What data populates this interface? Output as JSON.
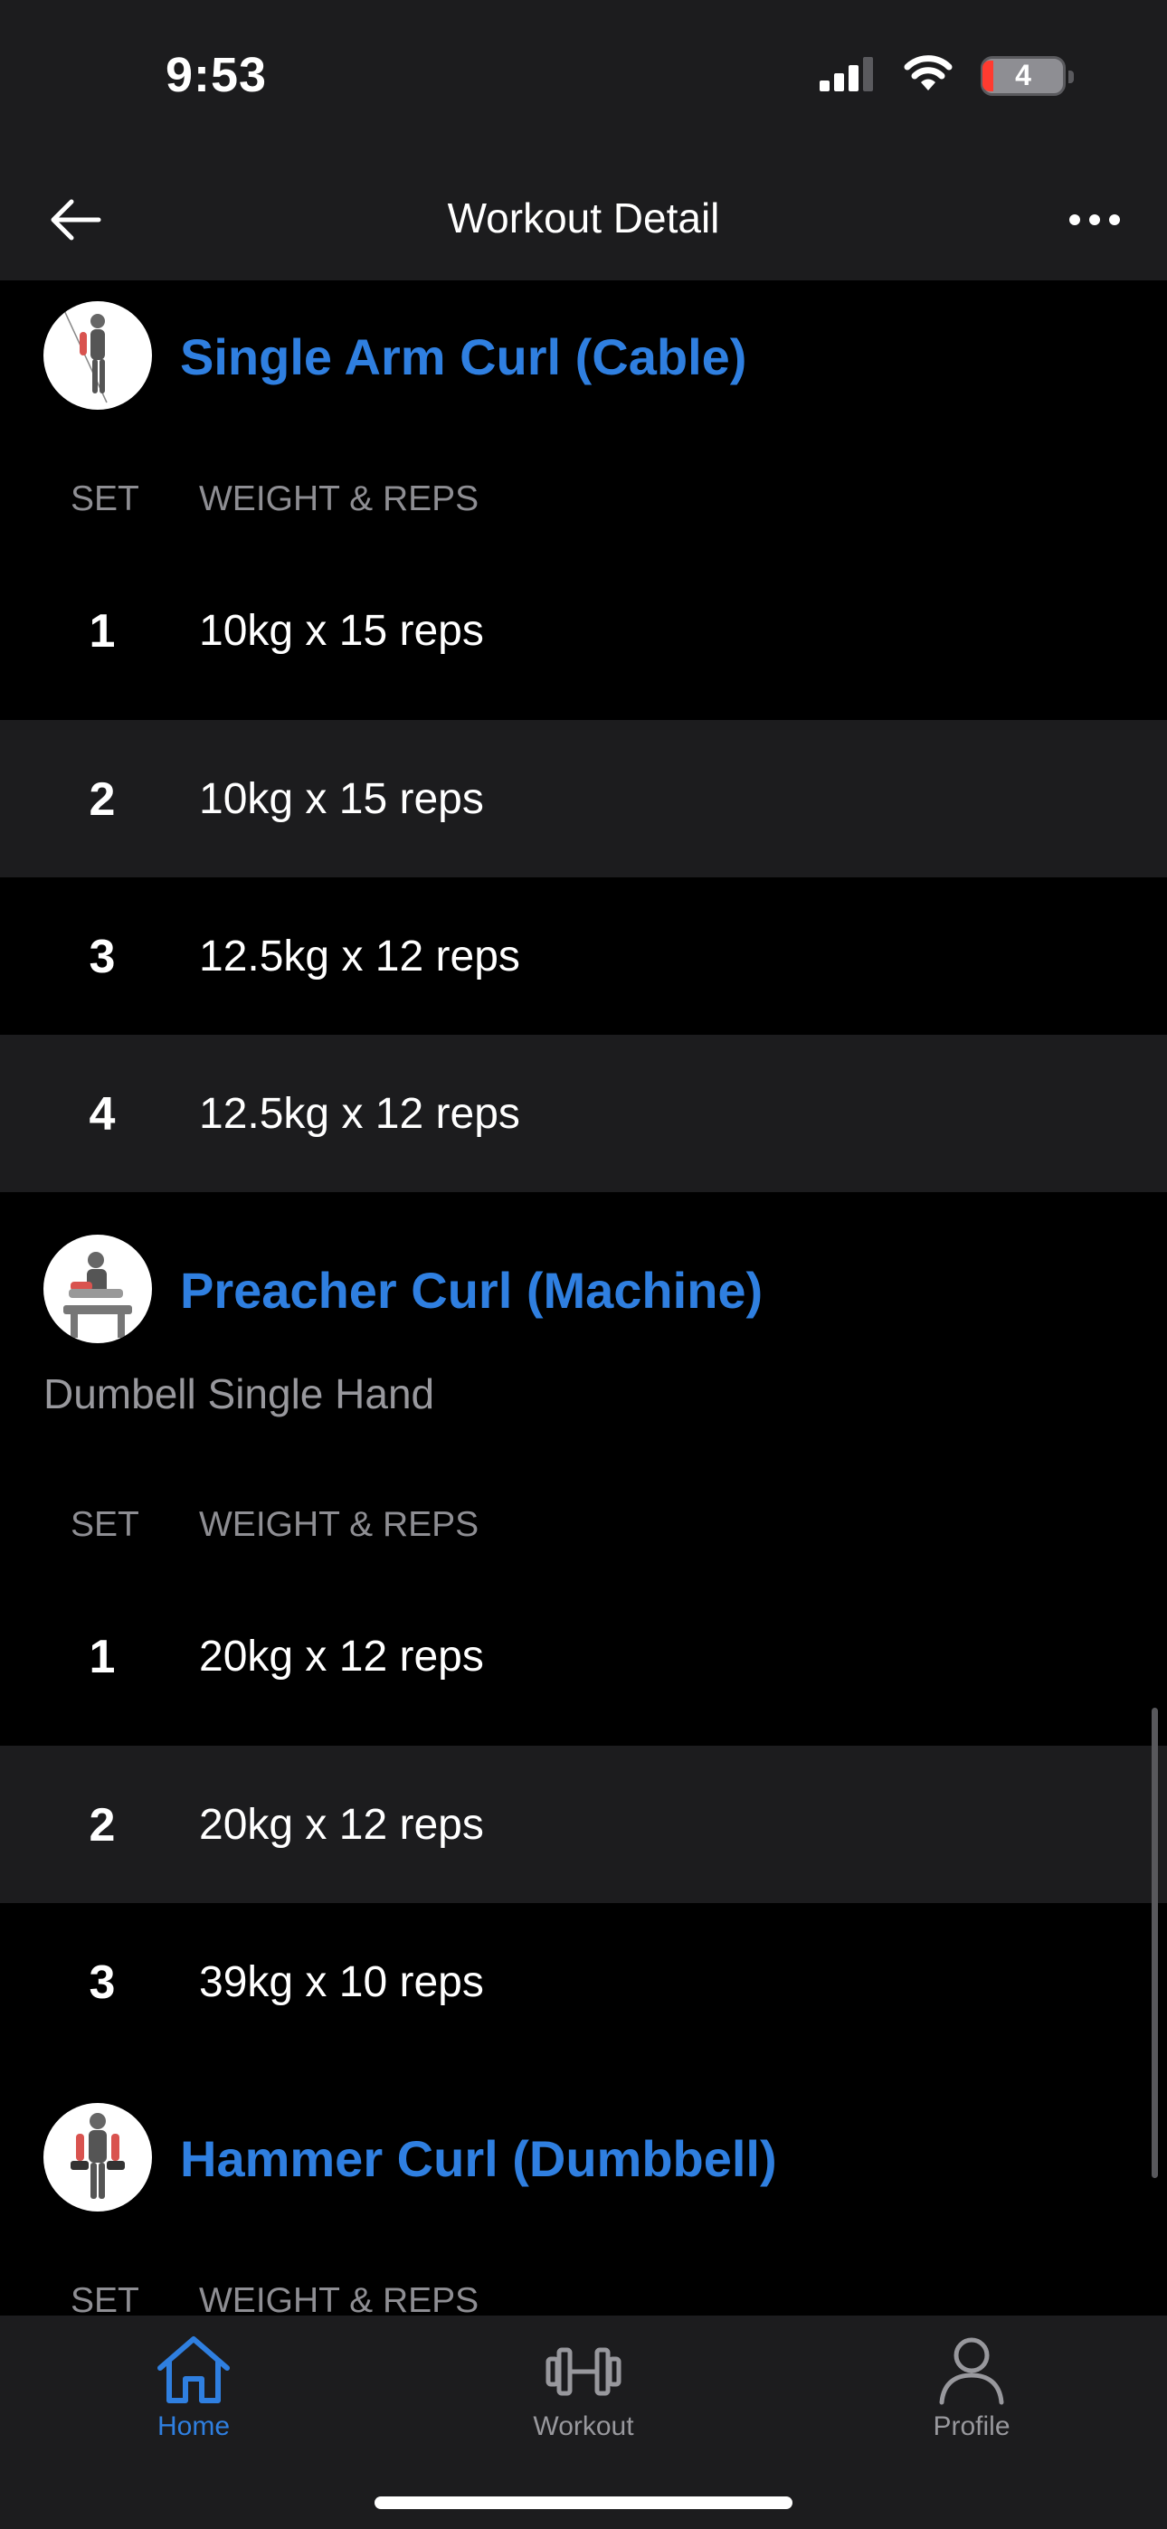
{
  "status_bar": {
    "time": "9:53",
    "battery": "4"
  },
  "nav": {
    "title": "Workout Detail"
  },
  "columns": {
    "set": "SET",
    "weight_reps": "WEIGHT & REPS"
  },
  "exercises": [
    {
      "name": "Single Arm Curl (Cable)",
      "sets": [
        {
          "num": "1",
          "value": "10kg x 15 reps"
        },
        {
          "num": "2",
          "value": "10kg x 15 reps"
        },
        {
          "num": "3",
          "value": "12.5kg x 12 reps"
        },
        {
          "num": "4",
          "value": "12.5kg x 12 reps"
        }
      ]
    },
    {
      "name": "Preacher Curl (Machine)",
      "note": "Dumbell Single Hand",
      "sets": [
        {
          "num": "1",
          "value": "20kg x 12 reps"
        },
        {
          "num": "2",
          "value": "20kg x 12 reps"
        },
        {
          "num": "3",
          "value": "39kg x 10 reps"
        }
      ]
    },
    {
      "name": "Hammer Curl (Dumbbell)",
      "sets": []
    }
  ],
  "tabs": [
    {
      "label": "Home",
      "icon": "home-icon",
      "active": true
    },
    {
      "label": "Workout",
      "icon": "dumbbell-icon",
      "active": false
    },
    {
      "label": "Profile",
      "icon": "person-icon",
      "active": false
    }
  ],
  "colors": {
    "accent": "#2f7fe0",
    "background": "#000000",
    "surface": "#1c1c1e"
  }
}
